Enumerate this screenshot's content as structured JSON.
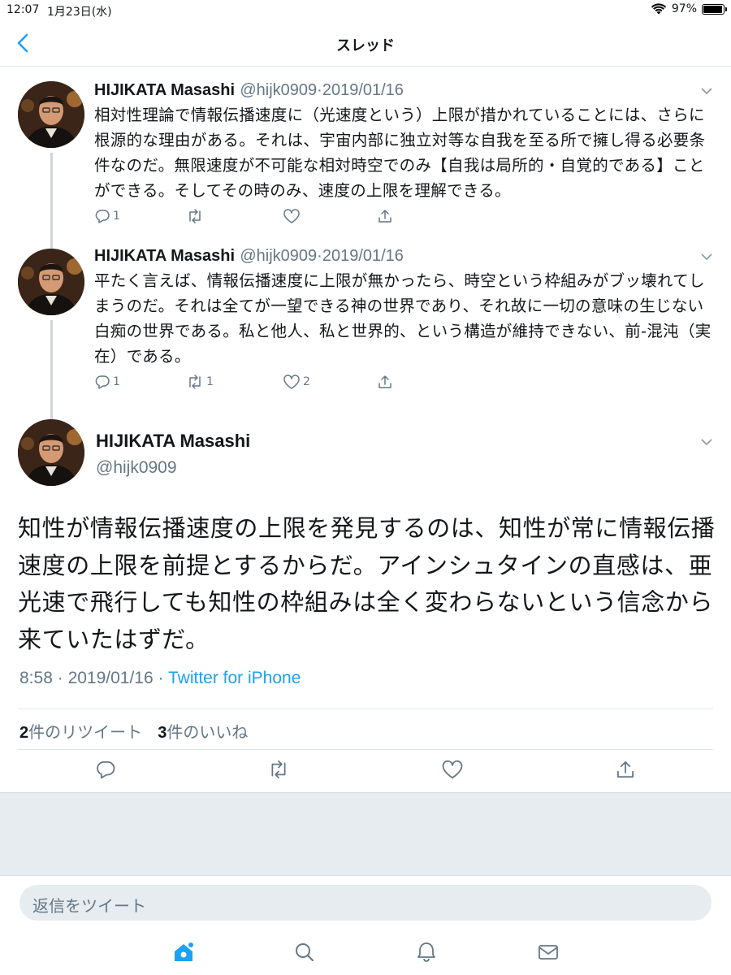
{
  "status_bar": {
    "time": "12:07",
    "date": "1月23日(水)",
    "battery": "97%"
  },
  "nav": {
    "title": "スレッド"
  },
  "thread": [
    {
      "name": "HIJIKATA Masashi",
      "handle": "@hijk0909",
      "date": "·2019/01/16",
      "text": "相対性理論で情報伝播速度に（光速度という）上限が措かれていることには、さらに根源的な理由がある。それは、宇宙内部に独立対等な自我を至る所で擁し得る必要条件なのだ。無限速度が不可能な相対時空でのみ【自我は局所的・自覚的である】ことができる。そしてその時のみ、速度の上限を理解できる。",
      "replies": "1",
      "retweets": "",
      "likes": ""
    },
    {
      "name": "HIJIKATA Masashi",
      "handle": "@hijk0909",
      "date": "·2019/01/16",
      "text": "平たく言えば、情報伝播速度に上限が無かったら、時空という枠組みがブッ壊れてしまうのだ。それは全てが一望できる神の世界であり、それ故に一切の意味の生じない白痴の世界である。私と他人、私と世界的、という構造が維持できない、前-混沌（実在）である。",
      "replies": "1",
      "retweets": "1",
      "likes": "2"
    }
  ],
  "main_tweet": {
    "name": "HIJIKATA Masashi",
    "handle": "@hijk0909",
    "text": "知性が情報伝播速度の上限を発見するのは、知性が常に情報伝播速度の上限を前提とするからだ。アインシュタインの直感は、亜光速で飛行しても知性の枠組みは全く変わらないという信念から来ていたはずだ。",
    "time": "8:58",
    "date": "2019/01/16",
    "source": "Twitter for iPhone",
    "retweet_count": "2",
    "retweet_label": "件のリツイート",
    "like_count": "3",
    "like_label": "件のいいね"
  },
  "reply": {
    "placeholder": "返信をツイート"
  },
  "tabs": [
    "home-icon",
    "search-icon",
    "notifications-icon",
    "messages-icon"
  ],
  "colors": {
    "accent": "#1da1f2",
    "muted": "#657786",
    "text": "#14171a"
  }
}
